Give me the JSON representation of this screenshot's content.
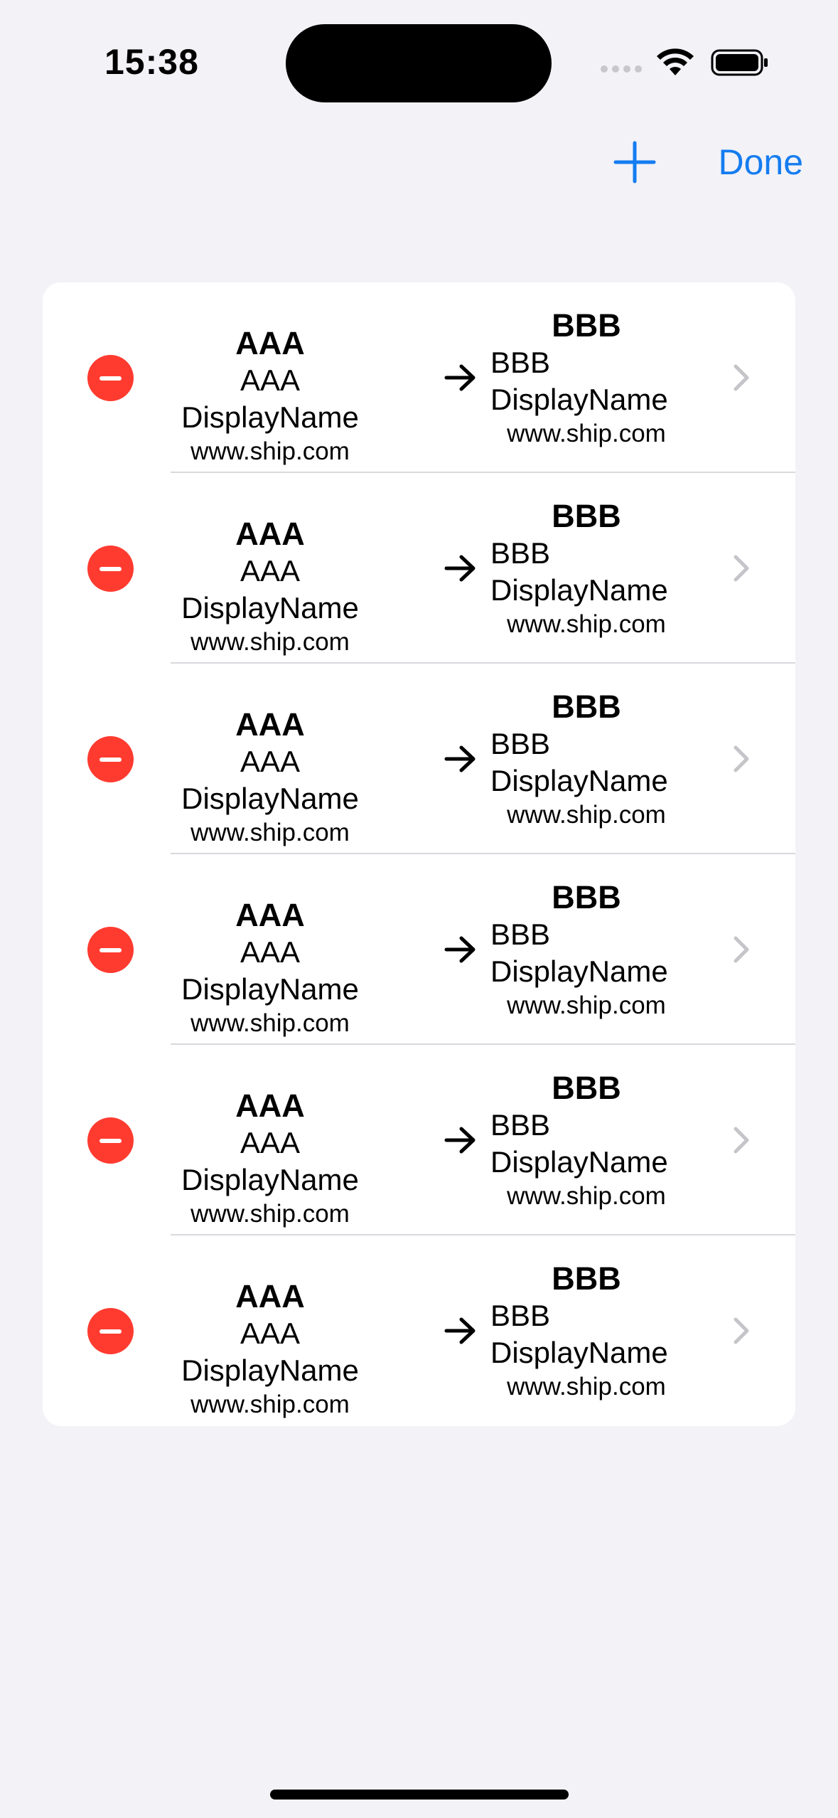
{
  "status_bar": {
    "time": "15:38"
  },
  "nav": {
    "done_label": "Done"
  },
  "colors": {
    "accent": "#147cf0",
    "delete": "#ff3b30",
    "background": "#f2f2f7"
  },
  "rows": [
    {
      "from_code": "AAA",
      "from_name": "AAA DisplayName",
      "from_url": "www.ship.com",
      "to_code": "BBB",
      "to_name_line1": "BBB",
      "to_name_line2": "DisplayName",
      "to_url": "www.ship.com"
    },
    {
      "from_code": "AAA",
      "from_name": "AAA DisplayName",
      "from_url": "www.ship.com",
      "to_code": "BBB",
      "to_name_line1": "BBB",
      "to_name_line2": "DisplayName",
      "to_url": "www.ship.com"
    },
    {
      "from_code": "AAA",
      "from_name": "AAA DisplayName",
      "from_url": "www.ship.com",
      "to_code": "BBB",
      "to_name_line1": "BBB",
      "to_name_line2": "DisplayName",
      "to_url": "www.ship.com"
    },
    {
      "from_code": "AAA",
      "from_name": "AAA DisplayName",
      "from_url": "www.ship.com",
      "to_code": "BBB",
      "to_name_line1": "BBB",
      "to_name_line2": "DisplayName",
      "to_url": "www.ship.com"
    },
    {
      "from_code": "AAA",
      "from_name": "AAA DisplayName",
      "from_url": "www.ship.com",
      "to_code": "BBB",
      "to_name_line1": "BBB",
      "to_name_line2": "DisplayName",
      "to_url": "www.ship.com"
    },
    {
      "from_code": "AAA",
      "from_name": "AAA DisplayName",
      "from_url": "www.ship.com",
      "to_code": "BBB",
      "to_name_line1": "BBB",
      "to_name_line2": "DisplayName",
      "to_url": "www.ship.com"
    }
  ]
}
